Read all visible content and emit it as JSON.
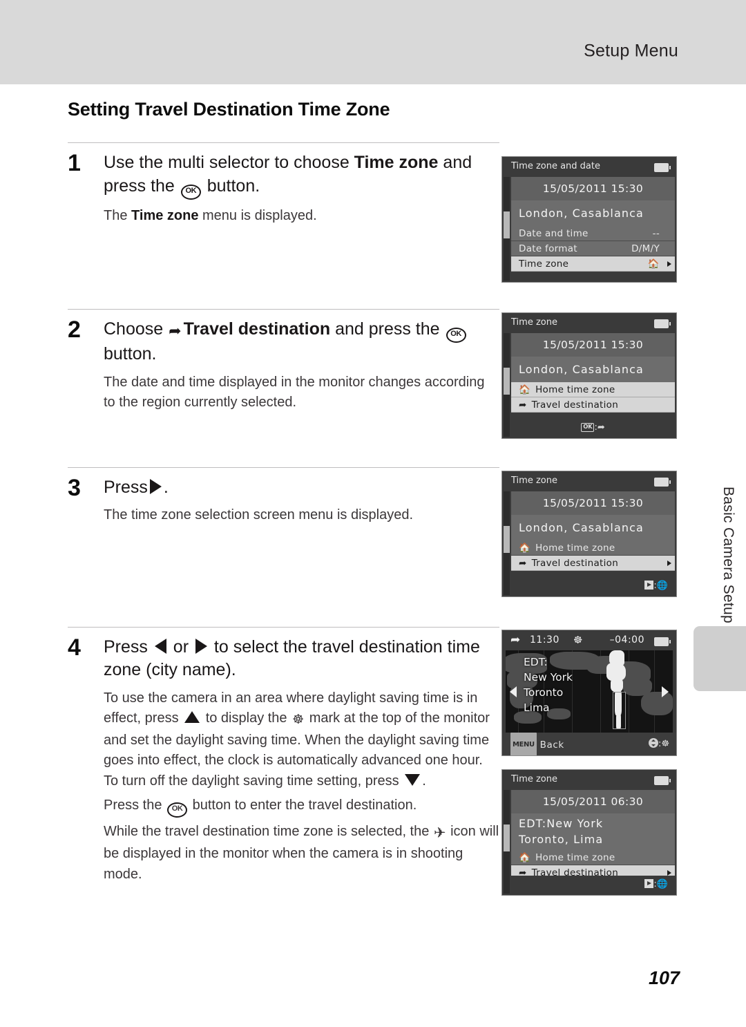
{
  "header": {
    "title": "Setup Menu"
  },
  "section": {
    "heading": "Setting Travel Destination Time Zone"
  },
  "side": {
    "chapter_label": "Basic Camera Setup"
  },
  "footer": {
    "page_number": "107"
  },
  "steps": [
    {
      "number": "1",
      "title_a": "Use the multi selector to choose ",
      "title_bold": "Time zone",
      "title_b": " and press the ",
      "title_c": " button.",
      "note_a": "The ",
      "note_bold": "Time zone",
      "note_b": " menu is displayed."
    },
    {
      "number": "2",
      "title_a": "Choose ",
      "title_bold": "Travel destination",
      "title_b": " and press the ",
      "title_c": " button.",
      "note": "The date and time displayed in the monitor changes according to the region currently selected."
    },
    {
      "number": "3",
      "title_a": "Press",
      "title_c": ".",
      "note": "The time zone selection screen menu is displayed."
    },
    {
      "number": "4",
      "title_a": "Press ",
      "title_mid": " or ",
      "title_b": " to select the travel destination time zone (city name).",
      "note1_a": "To use the camera in an area where daylight saving time is in effect, press ",
      "note1_b": " to display the ",
      "note1_c": " mark at the top of the monitor and set the daylight saving time. When the daylight saving time goes into effect, the clock is automatically advanced one hour. To turn off the daylight saving time setting, press ",
      "note1_d": ".",
      "note2_a": "Press the ",
      "note2_b": " button to enter the travel destination.",
      "note3_a": "While the travel destination time zone is selected, the ",
      "note3_b": " icon will be displayed in the monitor when the camera is in shooting mode."
    }
  ],
  "screens": [
    {
      "id": "screen-time-zone-and-date",
      "title": "Time zone and date",
      "datetime": "15/05/2011 15:30",
      "city": "London, Casablanca",
      "rows": [
        {
          "label": "Date and time",
          "value": "--",
          "selected": false,
          "arrow": false
        },
        {
          "label": "Date format",
          "value": "D/M/Y",
          "selected": false,
          "arrow": false
        },
        {
          "label": "Time zone",
          "value": "home-icon",
          "selected": true,
          "arrow": true
        }
      ],
      "footer": ""
    },
    {
      "id": "screen-time-zone-select-travel",
      "title": "Time zone",
      "datetime": "15/05/2011 15:30",
      "city": "London, Casablanca",
      "rows": [
        {
          "label": "Home time zone",
          "icon": "home-icon",
          "selected": false,
          "arrow": false
        },
        {
          "label": "Travel destination",
          "icon": "plane-icon",
          "selected": true,
          "arrow": false
        }
      ],
      "footer": "OK:plane"
    },
    {
      "id": "screen-time-zone-press-right",
      "title": "Time zone",
      "datetime": "15/05/2011 15:30",
      "city": "London, Casablanca",
      "rows": [
        {
          "label": "Home time zone",
          "icon": "home-icon",
          "selected": false,
          "arrow": false
        },
        {
          "label": "Travel destination",
          "icon": "plane-icon",
          "selected": true,
          "arrow": true
        }
      ],
      "footer": "play:globe"
    },
    {
      "id": "screen-world-map",
      "top_time": "11:30",
      "top_offset": "–04:00",
      "labels": [
        "EDT:",
        "New York",
        "Toronto",
        "Lima"
      ],
      "foot_menu": "MENU",
      "foot_back": "Back"
    },
    {
      "id": "screen-time-zone-confirmed",
      "title": "Time zone",
      "datetime": "15/05/2011 06:30",
      "city_line1": "EDT:New York",
      "city_line2": "Toronto, Lima",
      "rows": [
        {
          "label": "Home time zone",
          "icon": "home-icon",
          "selected": false,
          "arrow": false
        },
        {
          "label": "Travel destination",
          "icon": "plane-icon",
          "selected": true,
          "arrow": true
        }
      ],
      "footer": "play:globe"
    }
  ],
  "colors": {
    "header_band": "#d9d9d9",
    "screen_bg": "#3a3a3a",
    "screen_panel": "#6d6d6d",
    "screen_selected": "#d6d6d6",
    "map_bg": "#141414",
    "map_land": "#4e4e4e",
    "map_highlight": "#ededed",
    "side_tab": "#cfcfcf"
  }
}
